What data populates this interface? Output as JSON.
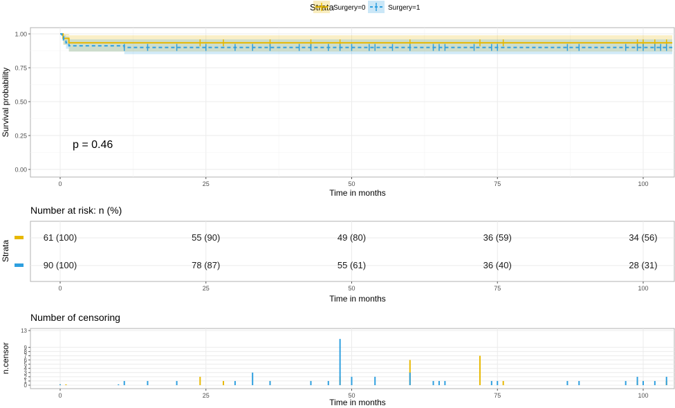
{
  "legend": {
    "title": "Strata",
    "items": [
      {
        "label": "Surgery=0",
        "color": "#E7B800"
      },
      {
        "label": "Surgery=1",
        "color": "#2E9FDF"
      }
    ]
  },
  "chart_data": [
    {
      "type": "line",
      "name": "survival-curve",
      "ylabel": "Survival probability",
      "xlabel": "Time in months",
      "xlim": [
        -10,
        105
      ],
      "ylim": [
        -0.05,
        1.05
      ],
      "xticks": [
        0,
        25,
        50,
        75,
        100
      ],
      "yticks": [
        0.0,
        0.25,
        0.5,
        0.75,
        1.0
      ],
      "ytick_labels": [
        "0.00",
        "0.25",
        "0.50",
        "0.75",
        "1.00"
      ],
      "annotation": "p = 0.46",
      "grid": true,
      "series": [
        {
          "name": "Surgery=0",
          "color": "#E7B800",
          "line": "solid",
          "steps": [
            [
              0,
              1.0
            ],
            [
              0.5,
              0.967
            ],
            [
              1.5,
              0.934
            ],
            [
              105,
              0.934
            ]
          ],
          "ci_band": [
            [
              0,
              1.0,
              1.0
            ],
            [
              0.5,
              0.92,
              1.0
            ],
            [
              1.5,
              0.87,
              0.99
            ],
            [
              105,
              0.87,
              0.99
            ]
          ],
          "censor_times": [
            24,
            28,
            36,
            43,
            48,
            60,
            72,
            76,
            99,
            100,
            102,
            104
          ]
        },
        {
          "name": "Surgery=1",
          "color": "#2E9FDF",
          "line": "dashed",
          "steps": [
            [
              0,
              1.0
            ],
            [
              0.3,
              0.978
            ],
            [
              0.6,
              0.956
            ],
            [
              1.0,
              0.934
            ],
            [
              1.5,
              0.912
            ],
            [
              11,
              0.9
            ],
            [
              105,
              0.9
            ]
          ],
          "ci_band": [
            [
              0,
              1.0,
              1.0
            ],
            [
              0.3,
              0.95,
              1.0
            ],
            [
              0.6,
              0.92,
              0.99
            ],
            [
              1.0,
              0.89,
              0.98
            ],
            [
              1.5,
              0.87,
              0.96
            ],
            [
              11,
              0.85,
              0.96
            ],
            [
              105,
              0.85,
              0.96
            ]
          ],
          "censor_times": [
            11,
            15,
            20,
            25,
            30,
            33,
            36,
            41,
            43,
            46,
            48,
            50,
            53,
            54,
            57,
            60,
            64,
            65,
            66,
            71,
            74,
            75,
            87,
            89,
            97,
            99,
            100,
            102,
            103,
            104
          ]
        }
      ]
    },
    {
      "type": "table",
      "name": "risk-table",
      "title": "Number at risk: n (%)",
      "ylabel": "Strata",
      "xlabel": "Time in months",
      "xticks": [
        0,
        25,
        50,
        75,
        100
      ],
      "rows": [
        {
          "name": "Surgery=0",
          "color": "#E7B800",
          "values": [
            "61 (100)",
            "55 (90)",
            "49 (80)",
            "36 (59)",
            "34 (56)"
          ]
        },
        {
          "name": "Surgery=1",
          "color": "#2E9FDF",
          "values": [
            "90 (100)",
            "78 (87)",
            "55 (61)",
            "36 (40)",
            "28 (31)"
          ]
        }
      ]
    },
    {
      "type": "bar",
      "name": "censoring-plot",
      "title": "Number of censoring",
      "ylabel": "n.censor",
      "xlabel": "Time in months",
      "xticks": [
        0,
        25,
        50,
        75,
        100
      ],
      "yticks": [
        0,
        1,
        2,
        3,
        4,
        5,
        6,
        7,
        8,
        9,
        13
      ],
      "ylim": [
        0,
        13
      ],
      "series": [
        {
          "name": "Surgery=0",
          "color": "#E7B800",
          "points": [
            [
              0,
              0.2
            ],
            [
              1,
              0.2
            ],
            [
              24,
              2
            ],
            [
              28,
              1
            ],
            [
              36,
              1
            ],
            [
              43,
              1
            ],
            [
              48,
              2
            ],
            [
              60,
              6
            ],
            [
              72,
              7
            ],
            [
              76,
              1
            ],
            [
              99,
              1
            ],
            [
              100,
              1
            ],
            [
              104,
              1
            ]
          ]
        },
        {
          "name": "Surgery=1",
          "color": "#2E9FDF",
          "points": [
            [
              0,
              0.2
            ],
            [
              10,
              0.2
            ],
            [
              11,
              1
            ],
            [
              15,
              1
            ],
            [
              20,
              1
            ],
            [
              30,
              1
            ],
            [
              33,
              3
            ],
            [
              36,
              1
            ],
            [
              43,
              1
            ],
            [
              46,
              1
            ],
            [
              48,
              11
            ],
            [
              50,
              2
            ],
            [
              54,
              2
            ],
            [
              60,
              3
            ],
            [
              64,
              1
            ],
            [
              65,
              1
            ],
            [
              66,
              1
            ],
            [
              74,
              1
            ],
            [
              75,
              1
            ],
            [
              87,
              1
            ],
            [
              89,
              1
            ],
            [
              97,
              1
            ],
            [
              99,
              2
            ],
            [
              100,
              1
            ],
            [
              102,
              1
            ],
            [
              104,
              2
            ]
          ]
        }
      ]
    }
  ]
}
